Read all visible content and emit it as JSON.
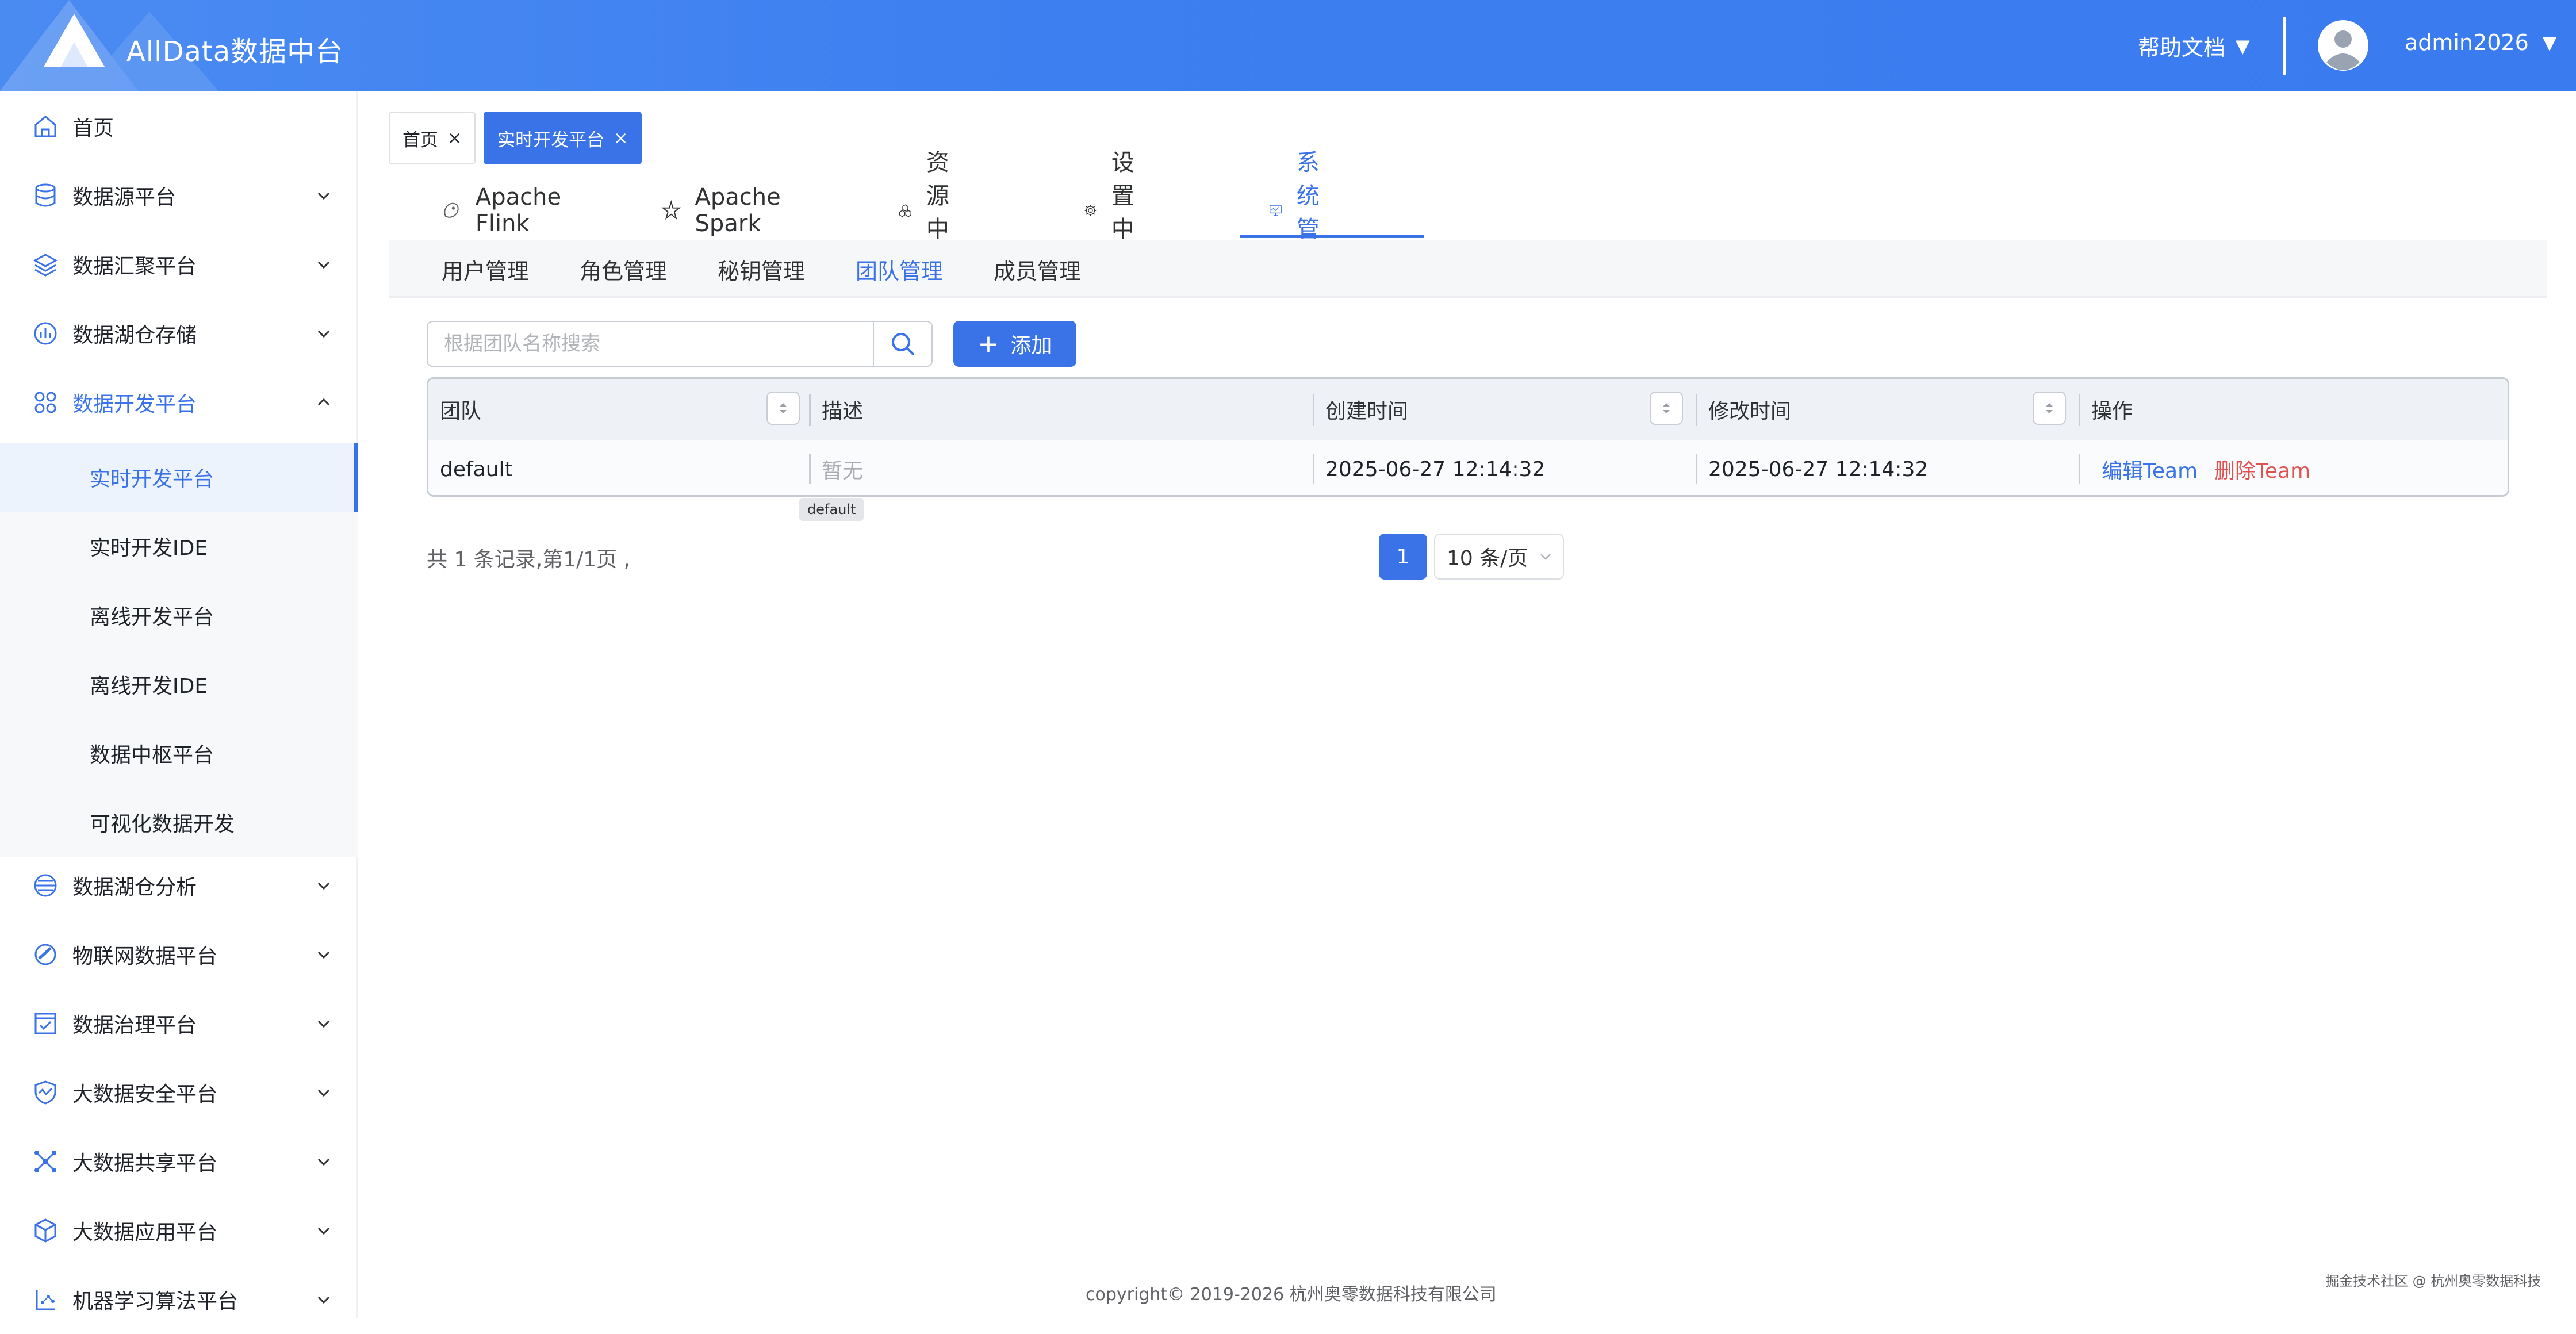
{
  "header": {
    "app_title": "AllData数据中台",
    "help_label": "帮助文档",
    "user_name": "admin2026",
    "caret": "▼"
  },
  "sidebar": {
    "items": [
      {
        "label": "首页",
        "icon": "home-icon"
      },
      {
        "label": "数据源平台",
        "icon": "database-icon"
      },
      {
        "label": "数据汇聚平台",
        "icon": "layers-icon"
      },
      {
        "label": "数据湖仓存储",
        "icon": "storage-icon"
      },
      {
        "label": "数据开发平台",
        "icon": "grid-icon",
        "expanded": true
      },
      {
        "label": "数据湖仓分析",
        "icon": "analysis-icon"
      },
      {
        "label": "物联网数据平台",
        "icon": "iot-icon"
      },
      {
        "label": "数据治理平台",
        "icon": "governance-icon"
      },
      {
        "label": "大数据安全平台",
        "icon": "shield-icon"
      },
      {
        "label": "大数据共享平台",
        "icon": "share-icon"
      },
      {
        "label": "大数据应用平台",
        "icon": "cube-icon"
      },
      {
        "label": "机器学习算法平台",
        "icon": "ml-icon"
      }
    ],
    "sub_items": [
      {
        "label": "实时开发平台",
        "active": true
      },
      {
        "label": "实时开发IDE"
      },
      {
        "label": "离线开发平台"
      },
      {
        "label": "离线开发IDE"
      },
      {
        "label": "数据中枢平台"
      },
      {
        "label": "可视化数据开发"
      }
    ]
  },
  "tags": [
    {
      "label": "首页",
      "close": "×"
    },
    {
      "label": "实时开发平台",
      "close": "×",
      "active": true
    }
  ],
  "top_nav": [
    {
      "label": "Apache Flink",
      "icon": "flink-icon"
    },
    {
      "label": "Apache Spark",
      "icon": "spark-icon"
    },
    {
      "label": "资源中心",
      "icon": "resource-icon"
    },
    {
      "label": "设置中心",
      "icon": "gear-icon"
    },
    {
      "label": "系统管理",
      "icon": "monitor-icon",
      "active": true
    }
  ],
  "sub_nav": [
    {
      "label": "用户管理"
    },
    {
      "label": "角色管理"
    },
    {
      "label": "秘钥管理"
    },
    {
      "label": "团队管理",
      "active": true
    },
    {
      "label": "成员管理"
    }
  ],
  "search": {
    "placeholder": "根据团队名称搜索",
    "value": ""
  },
  "add_button": {
    "icon": "+",
    "label": "添加"
  },
  "table": {
    "columns": [
      "团队",
      "描述",
      "创建时间",
      "修改时间",
      "操作"
    ],
    "rows": [
      {
        "team": "default",
        "description": "暂无",
        "created": "2025-06-27 12:14:32",
        "modified": "2025-06-27 12:14:32",
        "actions": {
          "edit": "编辑Team",
          "delete": "删除Team"
        }
      }
    ],
    "tooltip": "default"
  },
  "pagination": {
    "summary": "共 1 条记录,第1/1页 ,",
    "current_page": "1",
    "page_size": "10 条/页"
  },
  "footer": {
    "copyright": "copyright© 2019-2026 杭州奥零数据科技有限公司",
    "watermark": "掘金技术社区 @ 杭州奥零数据科技"
  },
  "colors": {
    "primary": "#3a72e8",
    "danger": "#e05252",
    "header": "#3d7ff0"
  }
}
